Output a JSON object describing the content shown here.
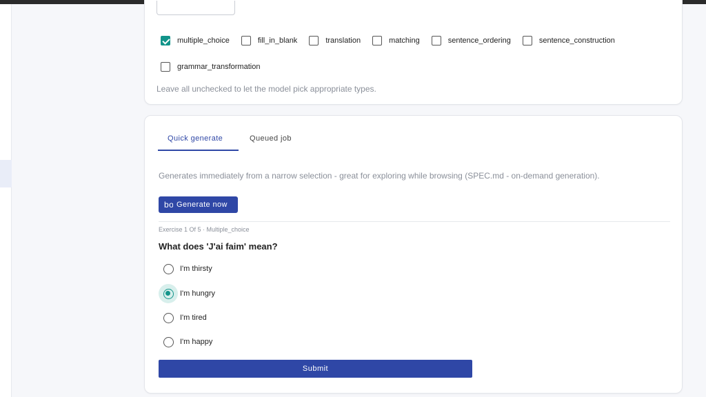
{
  "exercise_types": {
    "row1": [
      {
        "label": "multiple_choice",
        "checked": true
      },
      {
        "label": "fill_in_blank",
        "checked": false
      },
      {
        "label": "translation",
        "checked": false
      },
      {
        "label": "matching",
        "checked": false
      },
      {
        "label": "sentence_ordering",
        "checked": false
      },
      {
        "label": "sentence_construction",
        "checked": false
      }
    ],
    "row2": [
      {
        "label": "grammar_transformation",
        "checked": false
      }
    ],
    "hint": "Leave all unchecked to let the model pick appropriate types."
  },
  "tabs": [
    {
      "label": "Quick generate",
      "active": true
    },
    {
      "label": "Queued job",
      "active": false
    }
  ],
  "quick_generate": {
    "description": "Generates immediately from a narrow selection - great for exploring while browsing (SPEC.md - on-demand generation).",
    "generate_icon": "bolt-icon",
    "generate_icon_text": "bolt",
    "generate_label": "Generate now"
  },
  "exercise": {
    "meta": "Exercise 1 Of 5 · Multiple_choice",
    "question": "What does 'J'ai faim' mean?",
    "options": [
      {
        "label": "I'm thirsty",
        "selected": false
      },
      {
        "label": "I'm hungry",
        "selected": true
      },
      {
        "label": "I'm tired",
        "selected": false
      },
      {
        "label": "I'm happy",
        "selected": false
      }
    ],
    "submit_label": "Submit"
  },
  "colors": {
    "primary": "#2f47a6",
    "accent": "#12948a"
  }
}
